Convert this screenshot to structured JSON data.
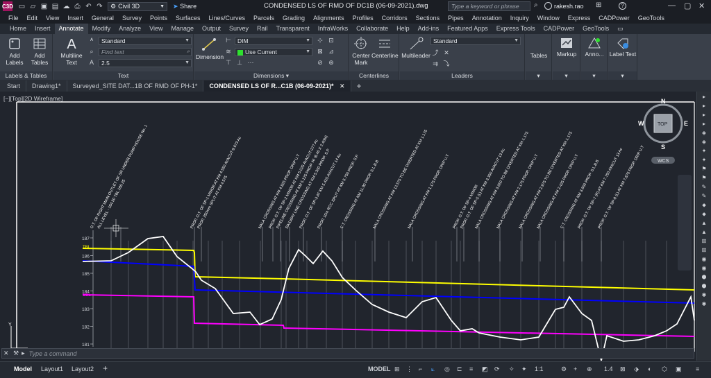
{
  "app": {
    "icon_text": "C3D",
    "workspace": "Civil 3D",
    "share": "Share",
    "title": "CONDENSED LS OF RMD OF DC1B (06-09-2021).dwg",
    "search_placeholder": "Type a keyword or phrase",
    "user": "rakesh.rao"
  },
  "menu": [
    "File",
    "Edit",
    "View",
    "Insert",
    "General",
    "Survey",
    "Points",
    "Surfaces",
    "Lines/Curves",
    "Parcels",
    "Grading",
    "Alignments",
    "Profiles",
    "Corridors",
    "Sections",
    "Pipes",
    "Annotation",
    "Inquiry",
    "Window",
    "Express",
    "CADPower",
    "GeoTools"
  ],
  "ribbon_tabs": [
    "Home",
    "Insert",
    "Annotate",
    "Modify",
    "Analyze",
    "View",
    "Manage",
    "Output",
    "Survey",
    "Rail",
    "Transparent",
    "InfraWorks",
    "Collaborate",
    "Help",
    "Add-ins",
    "Featured Apps",
    "Express Tools",
    "CADPower",
    "GeoTools"
  ],
  "ribbon_active": "Annotate",
  "ribbon": {
    "add_labels": "Add Labels",
    "add_tables": "Add Tables",
    "labels_tables": "Labels & Tables",
    "multiline_text": "Multiline Text",
    "text_style": "Standard",
    "find_text": "Find text",
    "text_height": "2.5",
    "text_panel": "Text",
    "dimension": "Dimension",
    "dim_style": "DIM",
    "layer": "Use Current",
    "dimensions_panel": "Dimensions",
    "center_mark": "Center Mark",
    "centerline": "Centerline",
    "centerlines_panel": "Centerlines",
    "multileader": "Multileader",
    "leader_style": "Standard",
    "leaders_panel": "Leaders",
    "tables": "Tables",
    "markup": "Markup",
    "anno": "Anno...",
    "label_text": "Label Text"
  },
  "doc_tabs": [
    "Start",
    "Drawing1*",
    "Surveyed_SITE DAT...1B OF RMD OF PH-1*",
    "CONDENSED LS OF R...C1B (06-09-2021)*"
  ],
  "view_label": "[−][Top][2D Wireframe]",
  "viewcube": {
    "n": "N",
    "s": "S",
    "e": "E",
    "w": "W",
    "top": "TOP",
    "wcs": "WCS"
  },
  "profile": {
    "y_ticks": [
      "187",
      "186",
      "185",
      "184",
      "183",
      "182",
      "181"
    ],
    "legend": [
      "TBL",
      "CBL"
    ],
    "annotations": [
      "O.T. OF RIGHT MAIN OUTLET OF SR UNDER PUMP HOUSE No. 1",
      "ALL LEVEL - 184.50 TBL 186.25",
      "PROP. O.T. OF SP-1 MINOR AT KM 4.550 AYACUT-9.673 Ac",
      "PROP. 250mm SPLIT AT KM 4.575",
      "NALA CROSSING AT KM 4.825 PROP. DRIP U.T",
      "PROP. O.T. OF SP-2 MINOR AT KM 5.025 AYACUT-277 Ac",
      "PIPELINE CROSSING AT KM 5.125 PROP. RI (6.40 X 2.40M)",
      "RAILWAY LINE CROSSING AT KM 5.300 PROP. S.P",
      "PROP. O.T. OF SP-3 AT KM 5.425 AYACUT 14 Ac",
      "PROP. 10m RCC SPLIT AT KM 5.750 PROP. S.P",
      "C.T. CROSSING AT KM 11.90 PROP. S.L.B.B",
      "NALA CROSSING AT KM 12.575 TO BE DIVERTED AT KM 1.175",
      "NALA CROSSING AT KM 1.175 PROP. DRIP U.T",
      "PROP. O.T. OF SP-4 MINOR",
      "PROP. O.T. OF SP-5 (L) AT KM 3.350 AYACUT 13 Ac",
      "NALA CROSSING AT KM 3.650 TO BE DIVERTED AT KM 1.175",
      "NALA CROSSING AT KM 2.175 PROP. DRIP U.T",
      "NALA CROSSING AT KM 2.975 TO BE DIVERTED AT KM 1.175",
      "NALA CROSSING AT KM 2.425 PROP. DRIP U.T",
      "C.T. CROSSING AT KM 3.650 PROP. S.L.B.B",
      "PROP. O.T. OF SP-7 (R) AT KM 7.750 AYACUT 13 Ac",
      "PROP. O.T. OF SP-8 (L) AT KM 7.875 PROP. DRIP U.T"
    ],
    "colors": {
      "tbl": "#ffff00",
      "fsl": "#0000ff",
      "cbl": "#ff00ff",
      "ground": "#ffffff",
      "bg": "#21252d"
    }
  },
  "command": {
    "placeholder": "Type a command"
  },
  "status": {
    "model": "Model",
    "layout1": "Layout1",
    "layout2": "Layout2",
    "model_btn": "MODEL",
    "scale": "1:1",
    "lineweight": "1.4"
  }
}
